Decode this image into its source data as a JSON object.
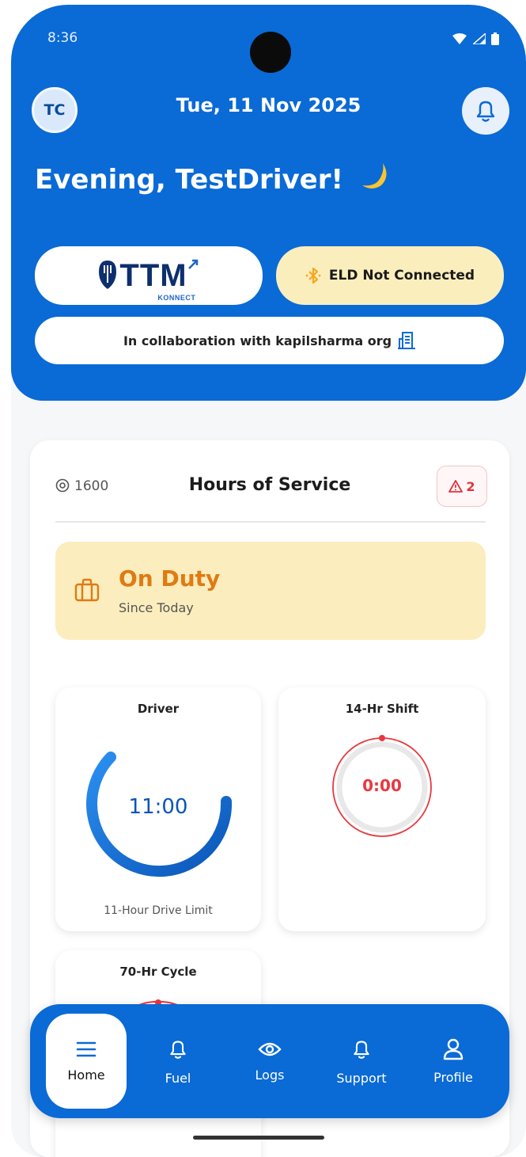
{
  "status_bar": {
    "time": "8:36"
  },
  "header": {
    "avatar_initials": "TC",
    "date": "Tue, 11 Nov 2025",
    "greeting": "Evening, TestDriver!",
    "logo": {
      "text": "TTM",
      "sub": "KONNECT"
    },
    "eld_status": "ELD Not Connected",
    "collaboration": "In collaboration with kapilsharma org"
  },
  "hos": {
    "location": "1600",
    "title": "Hours of Service",
    "alert_count": "2",
    "duty": {
      "status": "On Duty",
      "since": "Since Today"
    },
    "tiles": [
      {
        "title": "Driver",
        "value": "11:00",
        "footer": "11-Hour Drive Limit",
        "fraction": 1.0
      },
      {
        "title": "14-Hr Shift",
        "value": "0:00",
        "fraction": 0.0
      },
      {
        "title": "70-Hr Cycle"
      }
    ]
  },
  "nav": {
    "items": [
      {
        "label": "Home",
        "icon": "menu-icon",
        "active": true
      },
      {
        "label": "Fuel",
        "icon": "bell-icon"
      },
      {
        "label": "Logs",
        "icon": "eye-icon"
      },
      {
        "label": "Support",
        "icon": "bell-icon"
      },
      {
        "label": "Profile",
        "icon": "person-icon"
      }
    ]
  },
  "colors": {
    "primary": "#0a6ad6",
    "duty_bg": "#fbedbd",
    "duty_text": "#e07a12",
    "alert": "#e2333b"
  }
}
